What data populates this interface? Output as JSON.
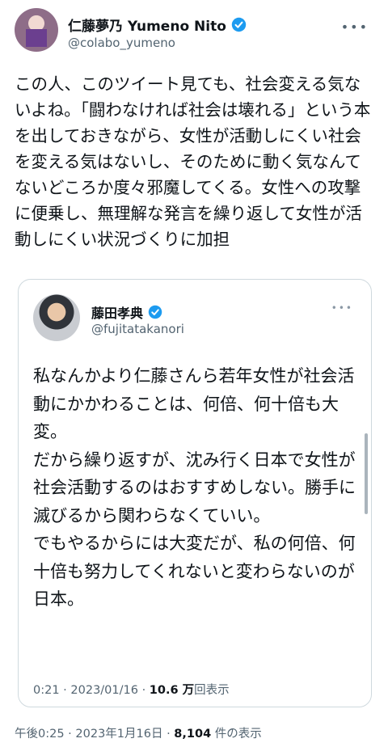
{
  "tweet": {
    "author_name": "仁藤夢乃 Yumeno Nito",
    "author_handle": "@colabo_yumeno",
    "avatar_sign_text": "性売買 合法化 反対",
    "text": "この人、このツイート見ても、社会変える気ないよね。「闘わなければ社会は壊れる」という本を出しておきながら、女性が活動しにくい社会を変える気はないし、そのために動く気なんてないどころか度々邪魔してくる。女性への攻撃に便乗し、無理解な発言を繰り返して女性が活動しにくい状況づくりに加担",
    "time": "午後0:25",
    "date": "2023年1月16日",
    "views_count": "8,104",
    "views_label": "件の表示"
  },
  "quoted": {
    "author_name": "藤田孝典",
    "author_handle": "@fujitatakanori",
    "text": "私なんかより仁藤さんら若年女性が社会活動にかかわることは、何倍、何十倍も大変。\nだから繰り返すが、沈み行く日本で女性が社会活動するのはおすすめしない。勝手に滅びるから関わらなくていい。\nでもやるからには大変だが、私の何倍、何十倍も努力してくれないと変わらないのが日本。",
    "time": "0:21",
    "date": "2023/01/16",
    "views_count": "10.6 万",
    "views_label": "回表示"
  },
  "icons": {
    "verified": "verified-badge-icon",
    "more": "more-icon"
  },
  "colors": {
    "verified_blue": "#1d9bf0",
    "secondary_text": "#536471",
    "border": "#cfd9de"
  }
}
